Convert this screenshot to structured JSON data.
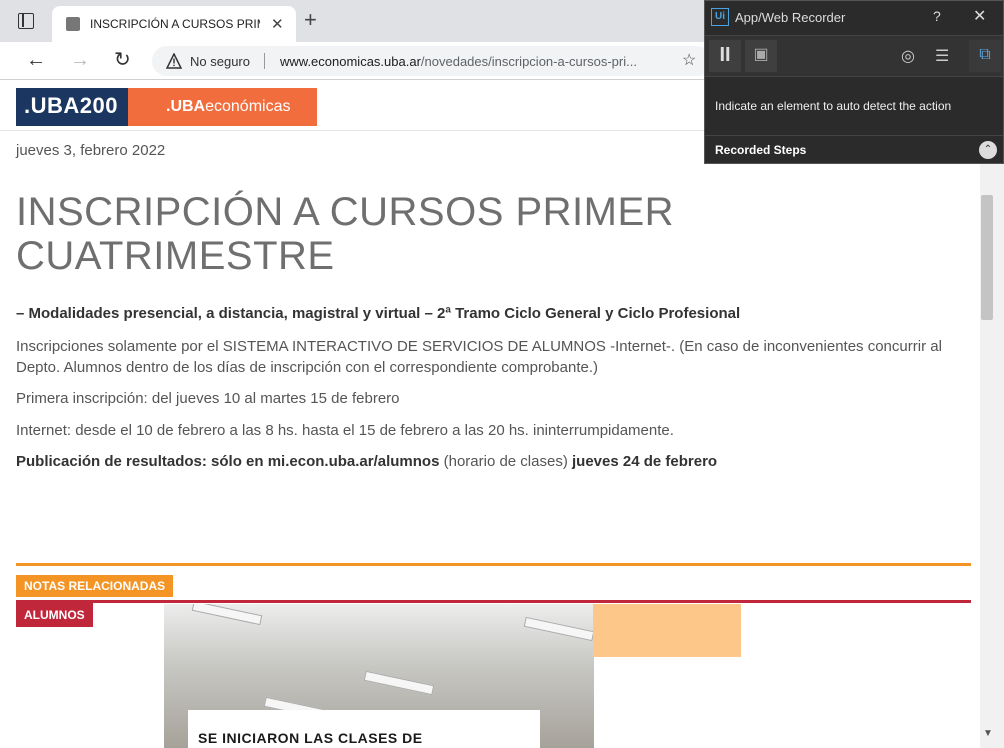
{
  "browser": {
    "tab": {
      "title": "INSCRIPCIÓN A CURSOS PRIMER CUATRIMESTRE",
      "close": "✕"
    },
    "new_tab": "+",
    "nav": {
      "back": "←",
      "forward": "→",
      "reload": "↻"
    },
    "address": {
      "security_label": "No seguro",
      "url_host": "www.economicas.uba.ar",
      "url_path": "/novedades/inscripcion-a-cursos-pri..."
    },
    "favorite": "☆"
  },
  "page": {
    "logo_uba": ".UBA200",
    "logo_eco_prefix": ".UBA",
    "logo_eco_suffix": "económicas",
    "date": "jueves 3, febrero 2022",
    "title": "INSCRIPCIÓN A CURSOS PRIMER CUATRIMESTRE",
    "subtitle": "– Modalidades presencial, a distancia, magistral y virtual – 2ª Tramo Ciclo General y Ciclo Profesional",
    "paragraph1": "Inscripciones solamente por el SISTEMA INTERACTIVO DE SERVICIOS DE ALUMNOS -Internet-. (En caso de inconvenientes concurrir al Depto. Alumnos dentro de los días de inscripción con el correspondiente comprobante.)",
    "paragraph2": "Primera inscripción: del jueves 10 al martes 15 de febrero",
    "paragraph3": "Internet: desde el 10 de febrero a las 8 hs. hasta el 15 de febrero a las 20 hs. ininterrumpidamente.",
    "paragraph4_bold1": "Publicación de resultados: sólo en mi.econ.uba.ar/alumnos",
    "paragraph4_normal": " (horario de clases) ",
    "paragraph4_bold2": "jueves 24 de febrero",
    "section_label": "NOTAS RELACIONADAS",
    "category_label": "ALUMNOS",
    "related_caption": "SE INICIARON LAS CLASES DE"
  },
  "recorder": {
    "logo": "Ui",
    "title": "App/Web Recorder",
    "help": "?",
    "close": "✕",
    "pause": "II",
    "hint": "Indicate an element to auto detect the action",
    "steps_label": "Recorded Steps",
    "steps_toggle": "⌃"
  },
  "colors": {
    "uba_blue": "#1b3660",
    "eco_orange": "#f26d3d",
    "section_orange": "#f39425",
    "alumnos_red": "#c0273a"
  }
}
